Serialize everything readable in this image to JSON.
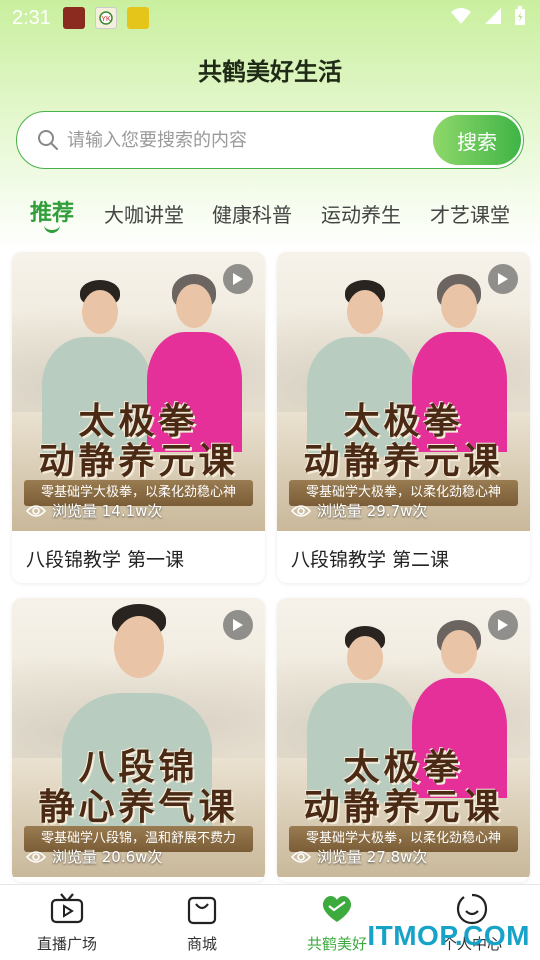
{
  "status_bar": {
    "time": "2:31"
  },
  "app": {
    "title": "共鹤美好生活"
  },
  "search": {
    "placeholder": "请输入您要搜索的内容",
    "button_label": "搜索"
  },
  "tabs": [
    {
      "label": "推荐",
      "active": true
    },
    {
      "label": "大咖讲堂",
      "active": false
    },
    {
      "label": "健康科普",
      "active": false
    },
    {
      "label": "运动养生",
      "active": false
    },
    {
      "label": "才艺课堂",
      "active": false
    }
  ],
  "cards": [
    {
      "big_title_line1": "太极拳",
      "big_title_line2": "动静养元课",
      "banner": "零基础学大极拳，以柔化劲稳心神",
      "views_label": "浏览量 14.1w次",
      "caption": "八段锦教学 第一课",
      "theme": "taiji"
    },
    {
      "big_title_line1": "太极拳",
      "big_title_line2": "动静养元课",
      "banner": "零基础学大极拳，以柔化劲稳心神",
      "views_label": "浏览量 29.7w次",
      "caption": "八段锦教学 第二课",
      "theme": "taiji"
    },
    {
      "big_title_line1": "八段锦",
      "big_title_line2": "静心养气课",
      "banner": "零基础学八段锦，温和舒展不费力",
      "views_label": "浏览量 20.6w次",
      "caption": "",
      "theme": "baduanjin"
    },
    {
      "big_title_line1": "太极拳",
      "big_title_line2": "动静养元课",
      "banner": "零基础学大极拳，以柔化劲稳心神",
      "views_label": "浏览量 27.8w次",
      "caption": "",
      "theme": "taiji"
    }
  ],
  "bottom_nav": [
    {
      "label": "直播广场",
      "icon": "tv-icon",
      "active": false
    },
    {
      "label": "商城",
      "icon": "shopping-bag-icon",
      "active": false
    },
    {
      "label": "共鹤美好",
      "icon": "heart-icon",
      "active": true
    },
    {
      "label": "个人中心",
      "icon": "smile-face-icon",
      "active": false
    }
  ],
  "watermark": "ITMOP.COM",
  "colors": {
    "accent": "#3daa3e",
    "search_border": "#48b24a",
    "top_gradient": "#c9ef9e"
  }
}
